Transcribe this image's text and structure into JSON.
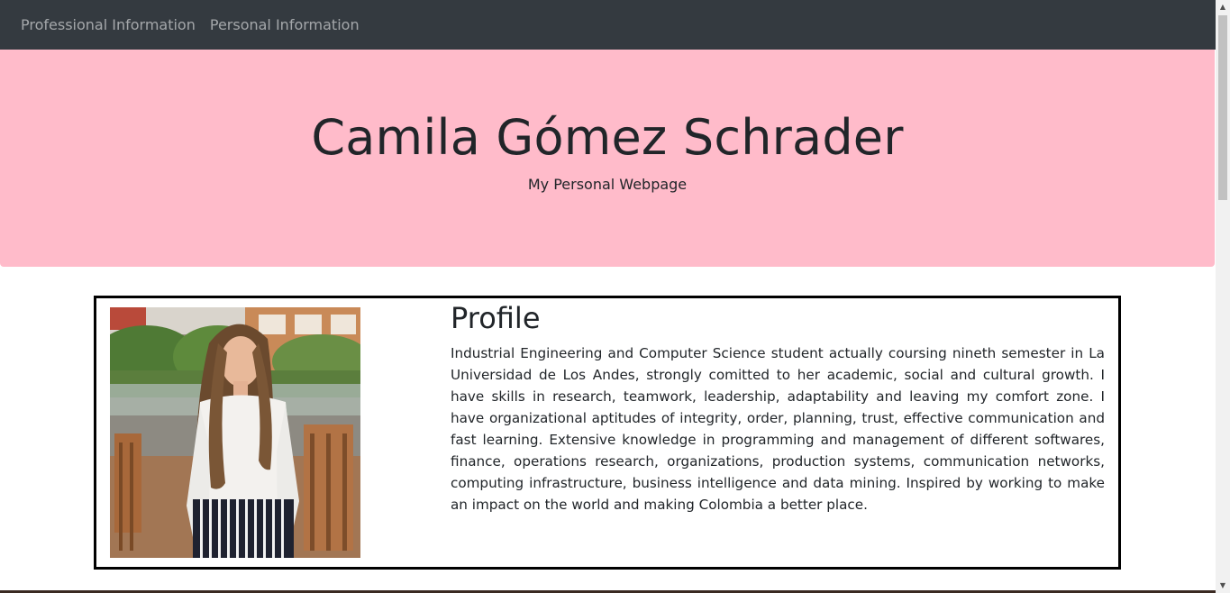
{
  "navbar": {
    "items": [
      {
        "label": "Professional Information"
      },
      {
        "label": "Personal Information"
      }
    ]
  },
  "hero": {
    "title": "Camila Gómez Schrader",
    "subtitle": "My Personal Webpage",
    "background": "#ffbbca"
  },
  "profile": {
    "heading": "Profile",
    "body": "Industrial Engineering and Computer Science student actually coursing nineth semester in La Universidad de Los Andes, strongly comitted to her academic, social and cultural growth. I have skills in research, teamwork, leadership, adaptability and leaving my comfort zone. I have organizational aptitudes of integrity, order, planning, trust, effective communication and fast learning. Extensive knowledge in programming and management of different softwares, finance, operations research, organizations, production systems, communication networks, computing infrastructure, business intelligence and data mining. Inspired by working to make an impact on the world and making Colombia a better place."
  },
  "colors": {
    "navbar": "#343a40",
    "nav_link": "rgba(255,255,255,0.55)",
    "card_border": "#000000"
  }
}
